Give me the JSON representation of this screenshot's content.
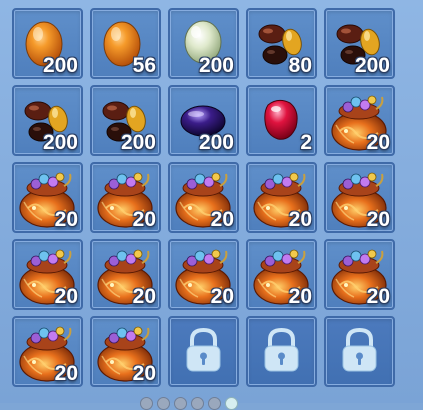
{
  "inventory": {
    "slots": [
      {
        "item": "orange-egg-icon",
        "count": "200"
      },
      {
        "item": "orange-egg-icon",
        "count": "56"
      },
      {
        "item": "pale-green-egg-icon",
        "count": "200"
      },
      {
        "item": "mixed-beans-icon",
        "count": "80"
      },
      {
        "item": "mixed-beans-icon",
        "count": "200"
      },
      {
        "item": "mixed-beans-icon",
        "count": "200"
      },
      {
        "item": "mixed-beans-icon",
        "count": "200"
      },
      {
        "item": "purple-bean-icon",
        "count": "200"
      },
      {
        "item": "red-gem-icon",
        "count": "2"
      },
      {
        "item": "treasure-pouch-icon",
        "count": "20"
      },
      {
        "item": "treasure-pouch-icon",
        "count": "20"
      },
      {
        "item": "treasure-pouch-icon",
        "count": "20"
      },
      {
        "item": "treasure-pouch-icon",
        "count": "20"
      },
      {
        "item": "treasure-pouch-icon",
        "count": "20"
      },
      {
        "item": "treasure-pouch-icon",
        "count": "20"
      },
      {
        "item": "treasure-pouch-icon",
        "count": "20"
      },
      {
        "item": "treasure-pouch-icon",
        "count": "20"
      },
      {
        "item": "treasure-pouch-icon",
        "count": "20"
      },
      {
        "item": "treasure-pouch-icon",
        "count": "20"
      },
      {
        "item": "treasure-pouch-icon",
        "count": "20"
      },
      {
        "item": "treasure-pouch-icon",
        "count": "20"
      },
      {
        "item": "treasure-pouch-icon",
        "count": "20"
      },
      {
        "item": "padlock-icon",
        "count": ""
      },
      {
        "item": "padlock-icon",
        "count": ""
      },
      {
        "item": "padlock-icon",
        "count": ""
      }
    ]
  },
  "colors": {
    "panel_bg": "#7ea6d6",
    "slot_bg": "#5f8fca",
    "slot_border": "#3f6aa8",
    "count_text": "#ffffff",
    "lock_color": "#cfe6f6"
  },
  "pagination": {
    "pages": 6,
    "active_index": 5
  }
}
